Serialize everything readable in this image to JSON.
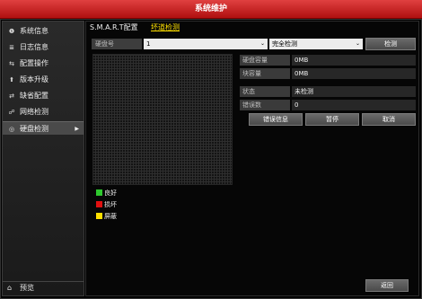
{
  "window": {
    "title": "系统维护"
  },
  "sidebar": {
    "items": [
      {
        "label": "系统信息",
        "icon": "info-icon",
        "glyph": "❶"
      },
      {
        "label": "日志信息",
        "icon": "log-icon",
        "glyph": "≣"
      },
      {
        "label": "配置操作",
        "icon": "config-icon",
        "glyph": "⇆"
      },
      {
        "label": "版本升级",
        "icon": "upgrade-icon",
        "glyph": "⬆"
      },
      {
        "label": "缺省配置",
        "icon": "reset-icon",
        "glyph": "⇄"
      },
      {
        "label": "网络检测",
        "icon": "network-icon",
        "glyph": "☍"
      },
      {
        "label": "硬盘检测",
        "icon": "disk-icon",
        "glyph": "◎",
        "active": true,
        "arrow": "▶"
      }
    ],
    "preview": {
      "label": "预览",
      "icon": "home-icon",
      "glyph": "⌂"
    }
  },
  "tabs": [
    {
      "label": "S.M.A.R.T配置"
    },
    {
      "label": "坏道检测",
      "active": true
    }
  ],
  "controls": {
    "disk_label": "硬盘号",
    "disk_value": "1",
    "mode_value": "完全检测",
    "dropdown_glyph": "⌄",
    "detect_button": "检测"
  },
  "info": {
    "capacity_label": "硬盘容量",
    "capacity_value": "0MB",
    "block_label": "块容量",
    "block_value": "0MB",
    "status_label": "状态",
    "status_value": "未检测",
    "errors_label": "错误数",
    "errors_value": "0"
  },
  "actions": {
    "error_info": "错误信息",
    "pause": "暂停",
    "cancel": "取消",
    "back": "返回"
  },
  "legend": [
    {
      "label": "良好",
      "color": "#2ec82e"
    },
    {
      "label": "损坏",
      "color": "#e01010"
    },
    {
      "label": "屏蔽",
      "color": "#ffe000"
    }
  ],
  "colors": {
    "title_bar": "#c82020",
    "active_tab": "#ffe000"
  }
}
